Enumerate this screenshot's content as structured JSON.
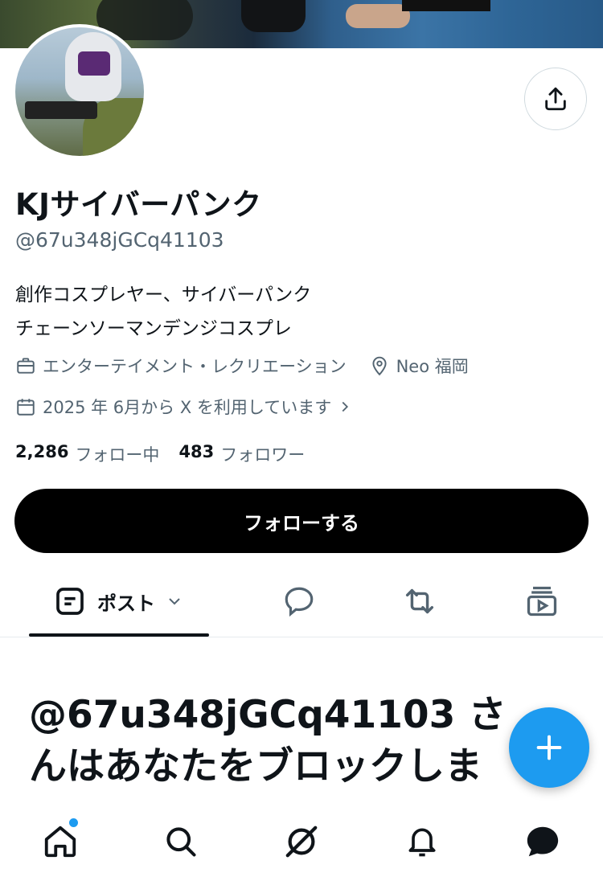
{
  "profile": {
    "display_name": "KJサイバーパンク",
    "handle": "@67u348jGCq41103",
    "bio_line1": "創作コスプレヤー、サイバーパンク",
    "bio_line2": "チェーンソーマンデンジコスプレ",
    "category": "エンターテイメント・レクリエーション",
    "location": "Neo 福岡",
    "joined": "2025 年 6月から X を利用しています",
    "following_count": "2,286",
    "following_label": "フォロー中",
    "followers_count": "483",
    "followers_label": "フォロワー"
  },
  "actions": {
    "follow_label": "フォローする"
  },
  "tabs": {
    "posts_label": "ポスト"
  },
  "blocked": {
    "line1": "@67u348jGCq41103 さ",
    "line2": "んはあなたをブロックしま"
  },
  "colors": {
    "accent": "#1d9bf0",
    "text_primary": "#0f1419",
    "text_secondary": "#536471",
    "follow_button_bg": "#000000"
  },
  "icons": {
    "share": "share-icon",
    "category": "briefcase-icon",
    "location": "location-pin-icon",
    "calendar": "calendar-icon",
    "posts_tab": "posts-icon",
    "dropdown": "chevron-down-icon",
    "replies_tab": "speech-bubble-icon",
    "reposts_tab": "repost-icon",
    "media_tab": "video-icon",
    "compose": "plus-icon",
    "nav_home": "home-icon",
    "nav_search": "search-icon",
    "nav_grok": "grok-icon",
    "nav_notifications": "bell-icon",
    "nav_messages": "message-icon"
  }
}
